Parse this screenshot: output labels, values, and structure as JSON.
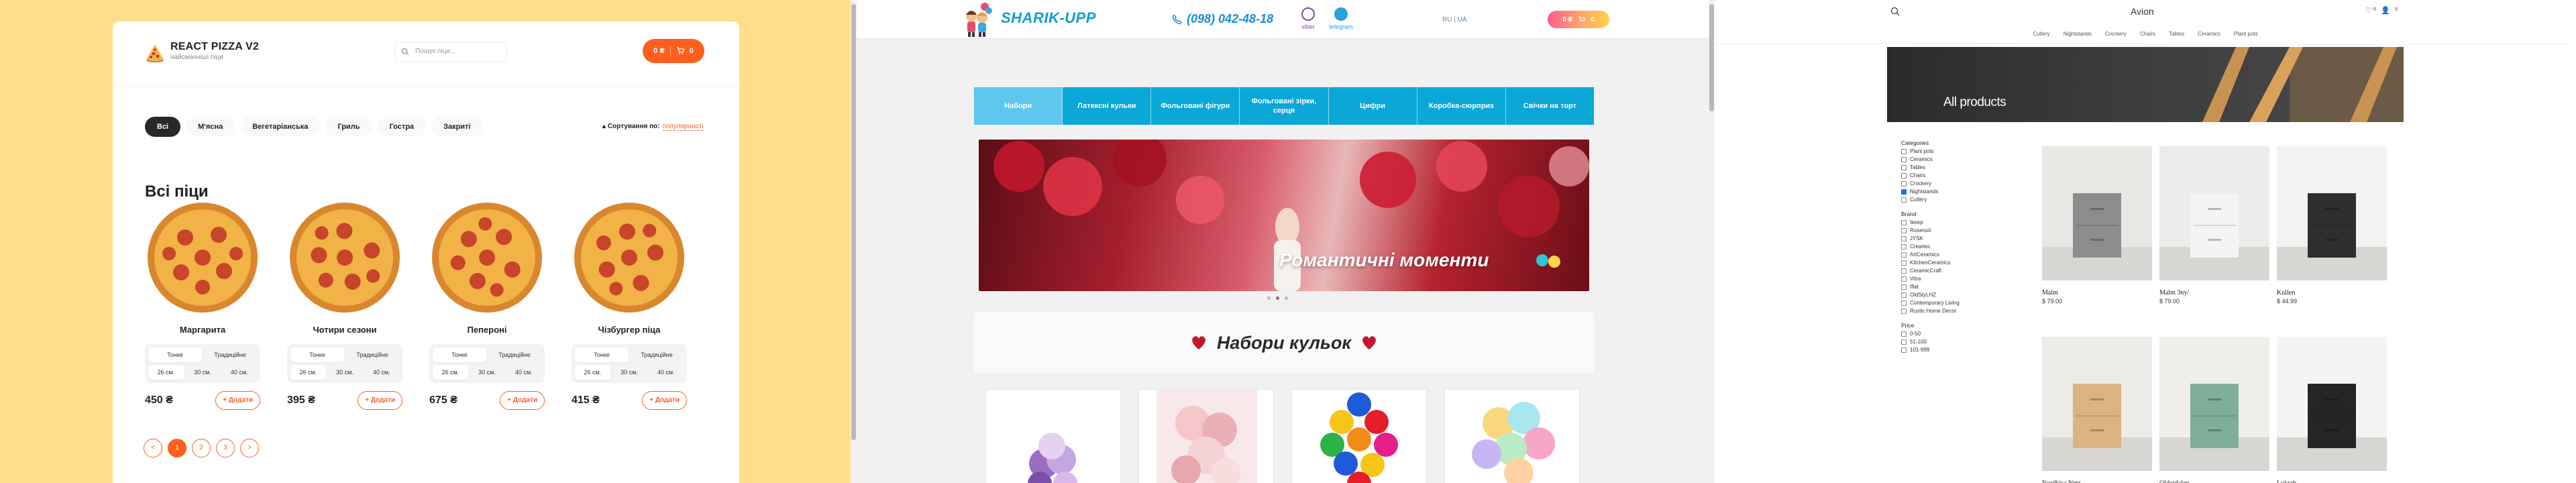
{
  "p1": {
    "title": "REACT PIZZA V2",
    "subtitle": "найсмачніші піци",
    "search_placeholder": "Пошук піци...",
    "cart": {
      "price": "0 ₴",
      "count": "0"
    },
    "categories": [
      "Всі",
      "М'ясна",
      "Вегетаріанська",
      "Гриль",
      "Гостра",
      "Закриті"
    ],
    "sort": {
      "label": "Сортування по:",
      "value": "популярності"
    },
    "heading": "Всі піци",
    "pizzas": [
      {
        "name": "Маргарита",
        "price": "450 ₴"
      },
      {
        "name": "Чотири сезони",
        "price": "395 ₴"
      },
      {
        "name": "Пепероні",
        "price": "675 ₴"
      },
      {
        "name": "Чізбургер піца",
        "price": "415 ₴"
      }
    ],
    "dough": [
      "Тонке",
      "Традиційне"
    ],
    "sizes": [
      "26 см.",
      "30 см.",
      "40 см."
    ],
    "add_label": "Додати",
    "pages": [
      "<",
      "1",
      "2",
      "3",
      ">"
    ]
  },
  "p2": {
    "brand": "SHARIK-UPP",
    "phone": "(098) 042-48-18",
    "viber": "viber",
    "telegram": "telegram",
    "lang": {
      "ru": "RU",
      "sep": " | ",
      "ua": "UA"
    },
    "cart": {
      "price": "0 ₴",
      "count": "0"
    },
    "menu": [
      "Набори",
      "Латексні кульки",
      "Фольговані фігури",
      "Фольговані зірки, серця",
      "Цифри",
      "Коробка-сюрприз",
      "Свічки на торт"
    ],
    "banner_text": "Романтичні моменти",
    "section_title": "Набори кульок",
    "colors": {
      "accent": "#0aa7d7",
      "brand": "#139ed0"
    }
  },
  "p3": {
    "store": "Avion",
    "top_icons": "♡⁰ 👤 ⁰",
    "nav": [
      "Cutlery",
      "Nightstands",
      "Crockery",
      "Chairs",
      "Tables",
      "Ceramics",
      "Plant pots"
    ],
    "hero": "All products",
    "filters": {
      "categories_title": "Categories",
      "categories": [
        {
          "label": "Plant pots",
          "checked": false
        },
        {
          "label": "Ceramics",
          "checked": false
        },
        {
          "label": "Tables",
          "checked": false
        },
        {
          "label": "Chairs",
          "checked": false
        },
        {
          "label": "Crockery",
          "checked": false
        },
        {
          "label": "Nightstands",
          "checked": true
        },
        {
          "label": "Cutlery",
          "checked": false
        }
      ],
      "brand_title": "Brand",
      "brands": [
        "Ikeep",
        "Rosenoil",
        "JYSK",
        "Creartec",
        "ArtCeramics",
        "KitchenCeramics",
        "CeramicCraft",
        "Vitra",
        "Iflat",
        "OldStyLHZ",
        "Contemporary Living",
        "Rustic Home Decor"
      ],
      "price_title": "Price",
      "prices": [
        "0-50",
        "51-100",
        "101-999"
      ]
    },
    "products": [
      {
        "name": "Malm",
        "price": "$ 79.00"
      },
      {
        "name": "Malm 3ny/",
        "price": "$ 79.00"
      },
      {
        "name": "Kullen",
        "price": "$ 44.99"
      },
      {
        "name": "Nordkisa Nmr",
        "price": ""
      },
      {
        "name": "Olderdalen",
        "price": ""
      },
      {
        "name": "Lukrab",
        "price": ""
      }
    ]
  }
}
